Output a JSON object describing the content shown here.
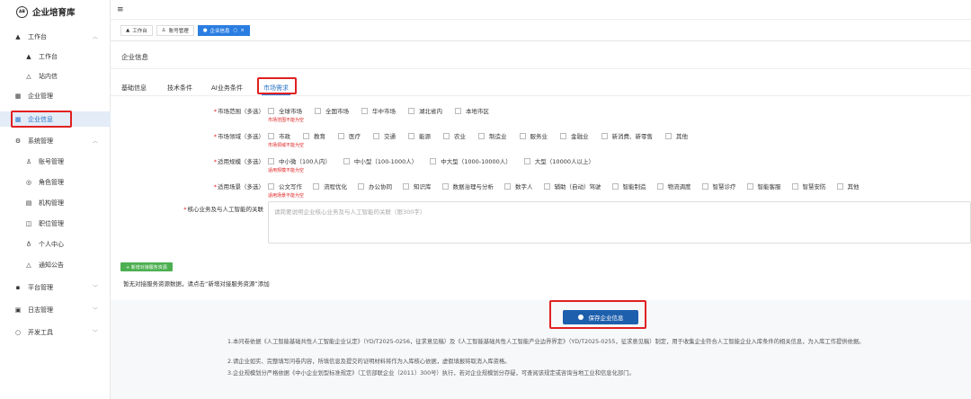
{
  "app": {
    "logo_mark": "AB",
    "title": "企业培育库"
  },
  "sidebar": {
    "workbench": "工作台",
    "workbench_sub": "工作台",
    "inbox": "站内信",
    "enterprise_mgmt": "企业管理",
    "enterprise_info": "企业信息",
    "system_mgmt": "系统管理",
    "account_mgmt": "账号管理",
    "role_mgmt": "角色管理",
    "org_mgmt": "机构管理",
    "post_mgmt": "职位管理",
    "personal_center": "个人中心",
    "notice": "通知公告",
    "platform_mgmt": "平台管理",
    "log_mgmt": "日志管理",
    "dev_tools": "开发工具"
  },
  "topbar": {
    "menu_icon": "≡"
  },
  "tabs": {
    "t1": "工作台",
    "t2": "账号管理",
    "t3": "企业信息"
  },
  "card": {
    "title": "企业信息"
  },
  "form_tabs": {
    "basic": "基础信息",
    "tech": "技术条件",
    "ai": "AI业务条件",
    "market": "市场需求"
  },
  "fields": {
    "market_range": {
      "label": "市场范围（多选）",
      "error": "市场范围不能为空",
      "options": [
        "全球市场",
        "全国市场",
        "华中市场",
        "湖北省内",
        "本地市区"
      ]
    },
    "market_field": {
      "label": "市场领域（多选）",
      "error": "市场领域不能为空",
      "options": [
        "市政",
        "教育",
        "医疗",
        "交通",
        "能源",
        "农业",
        "制造业",
        "服务业",
        "金融业",
        "新消费、新零售",
        "其他"
      ]
    },
    "scale": {
      "label": "适用规模（多选）",
      "error": "适用规模不能为空",
      "options": [
        "中小微（100人内）",
        "中小型（100-1000人）",
        "中大型（1000-10000人）",
        "大型（10000人以上）"
      ]
    },
    "scenario": {
      "label": "适用场景（多选）",
      "error": "适用场景不能为空",
      "options": [
        "公文写作",
        "流程优化",
        "办公协同",
        "知识库",
        "数据治理与分析",
        "数字人",
        "辅助（自动）驾驶",
        "智能制造",
        "物流调度",
        "智慧诊疗",
        "智能客服",
        "智慧安防",
        "其他"
      ]
    },
    "core": {
      "label": "核心业务及与人工智能的关联",
      "placeholder": "请简要说明企业核心业务及与人工智能的关联（限300字）"
    }
  },
  "actions": {
    "add_resource": "+ 新增对接服务资源",
    "empty_text": "暂无对接服务资源数据，请点击“新增对接服务资源”添加",
    "save": "保存企业信息"
  },
  "notes": [
    "1.本问卷依据《人工智能基础共性人工智能企业认定》（YD/T2025-0256，征求意见稿）及《人工智能基础共性人工智能产业边界界定》（YD/T2025-0255，征求意见稿）制定，用于收集企业符合人工智能企业入库条件的相关信息，为入库工作提供依据。",
    "2.请企业如实、完整填写问卷内容，所填信息及提交的证明材料将作为入库核心依据，虚假填报将取消入库资格。",
    "3.企业规模划分严格依据《中小企业划型标准规定》（工信部联企业〔2011〕300号）执行，若对企业规模划分存疑，可查阅该规定或咨询当地工业和信息化部门。"
  ]
}
